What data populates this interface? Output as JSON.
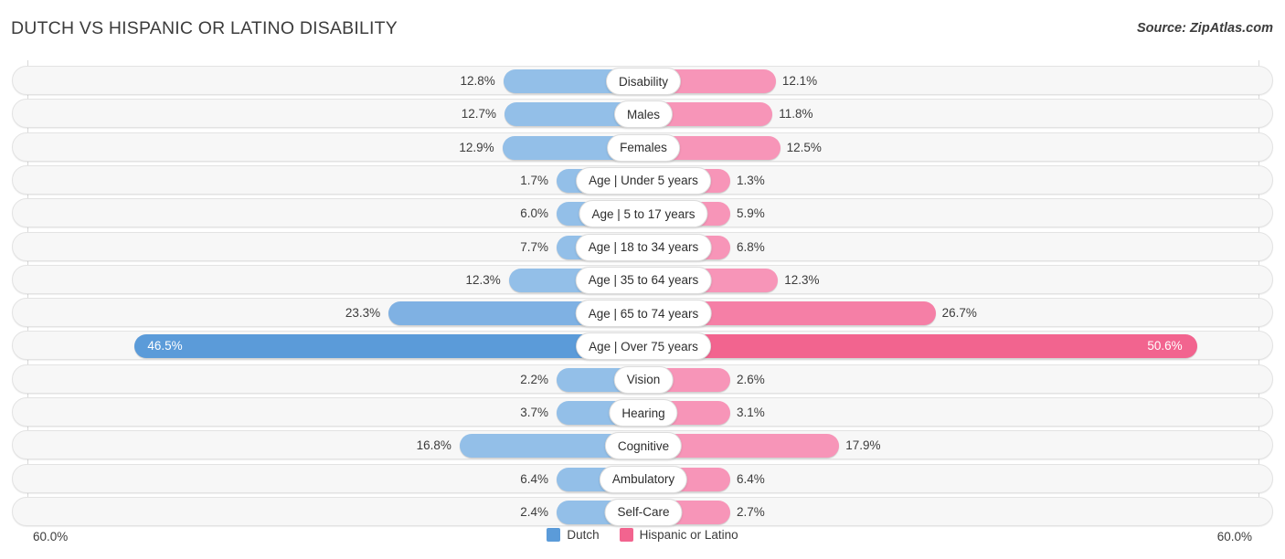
{
  "header": {
    "title": "DUTCH VS HISPANIC OR LATINO DISABILITY",
    "source": "Source: ZipAtlas.com"
  },
  "axis": {
    "left_label": "60.0%",
    "right_label": "60.0%"
  },
  "legend": {
    "items": [
      {
        "label": "Dutch",
        "color": "#5b9bd9"
      },
      {
        "label": "Hispanic or Latino",
        "color": "#f2648f"
      }
    ]
  },
  "chart_data": {
    "type": "bar",
    "title": "DUTCH VS HISPANIC OR LATINO DISABILITY",
    "subtitle": "Source: ZipAtlas.com",
    "orientation": "horizontal-diverging",
    "xlabel": "",
    "ylabel": "",
    "xlim": [
      60.0,
      60.0
    ],
    "axis_max_percent": 60.0,
    "grid": true,
    "legend_position": "bottom-center",
    "categories": [
      "Disability",
      "Males",
      "Females",
      "Age | Under 5 years",
      "Age | 5 to 17 years",
      "Age | 18 to 34 years",
      "Age | 35 to 64 years",
      "Age | 65 to 74 years",
      "Age | Over 75 years",
      "Vision",
      "Hearing",
      "Cognitive",
      "Ambulatory",
      "Self-Care"
    ],
    "series": [
      {
        "name": "Dutch",
        "color": "#93bfe8",
        "values": [
          12.8,
          12.7,
          12.9,
          1.7,
          6.0,
          7.7,
          12.3,
          23.3,
          46.5,
          2.2,
          3.7,
          16.8,
          6.4,
          2.4
        ],
        "labels": [
          "12.8%",
          "12.7%",
          "12.9%",
          "1.7%",
          "6.0%",
          "7.7%",
          "12.3%",
          "23.3%",
          "46.5%",
          "2.2%",
          "3.7%",
          "16.8%",
          "6.4%",
          "2.4%"
        ]
      },
      {
        "name": "Hispanic or Latino",
        "color": "#f795b8",
        "values": [
          12.1,
          11.8,
          12.5,
          1.3,
          5.9,
          6.8,
          12.3,
          26.7,
          50.6,
          2.6,
          3.1,
          17.9,
          6.4,
          2.7
        ],
        "labels": [
          "12.1%",
          "11.8%",
          "12.5%",
          "1.3%",
          "5.9%",
          "6.8%",
          "12.3%",
          "26.7%",
          "50.6%",
          "2.6%",
          "3.1%",
          "17.9%",
          "6.4%",
          "2.7%"
        ]
      }
    ]
  },
  "rows": [
    {
      "label": "Disability",
      "left": {
        "value": 12.8,
        "text": "12.8%"
      },
      "right": {
        "value": 12.1,
        "text": "12.1%"
      }
    },
    {
      "label": "Males",
      "left": {
        "value": 12.7,
        "text": "12.7%"
      },
      "right": {
        "value": 11.8,
        "text": "11.8%"
      }
    },
    {
      "label": "Females",
      "left": {
        "value": 12.9,
        "text": "12.9%"
      },
      "right": {
        "value": 12.5,
        "text": "12.5%"
      }
    },
    {
      "label": "Age | Under 5 years",
      "left": {
        "value": 1.7,
        "text": "1.7%"
      },
      "right": {
        "value": 1.3,
        "text": "1.3%"
      }
    },
    {
      "label": "Age | 5 to 17 years",
      "left": {
        "value": 6.0,
        "text": "6.0%"
      },
      "right": {
        "value": 5.9,
        "text": "5.9%"
      }
    },
    {
      "label": "Age | 18 to 34 years",
      "left": {
        "value": 7.7,
        "text": "7.7%"
      },
      "right": {
        "value": 6.8,
        "text": "6.8%"
      }
    },
    {
      "label": "Age | 35 to 64 years",
      "left": {
        "value": 12.3,
        "text": "12.3%"
      },
      "right": {
        "value": 12.3,
        "text": "12.3%"
      }
    },
    {
      "label": "Age | 65 to 74 years",
      "left": {
        "value": 23.3,
        "text": "23.3%"
      },
      "right": {
        "value": 26.7,
        "text": "26.7%"
      }
    },
    {
      "label": "Age | Over 75 years",
      "left": {
        "value": 46.5,
        "text": "46.5%"
      },
      "right": {
        "value": 50.6,
        "text": "50.6%"
      }
    },
    {
      "label": "Vision",
      "left": {
        "value": 2.2,
        "text": "2.2%"
      },
      "right": {
        "value": 2.6,
        "text": "2.6%"
      }
    },
    {
      "label": "Hearing",
      "left": {
        "value": 3.7,
        "text": "3.7%"
      },
      "right": {
        "value": 3.1,
        "text": "3.1%"
      }
    },
    {
      "label": "Cognitive",
      "left": {
        "value": 16.8,
        "text": "16.8%"
      },
      "right": {
        "value": 17.9,
        "text": "17.9%"
      }
    },
    {
      "label": "Ambulatory",
      "left": {
        "value": 6.4,
        "text": "6.4%"
      },
      "right": {
        "value": 6.4,
        "text": "6.4%"
      }
    },
    {
      "label": "Self-Care",
      "left": {
        "value": 2.4,
        "text": "2.4%"
      },
      "right": {
        "value": 2.7,
        "text": "2.7%"
      }
    }
  ]
}
